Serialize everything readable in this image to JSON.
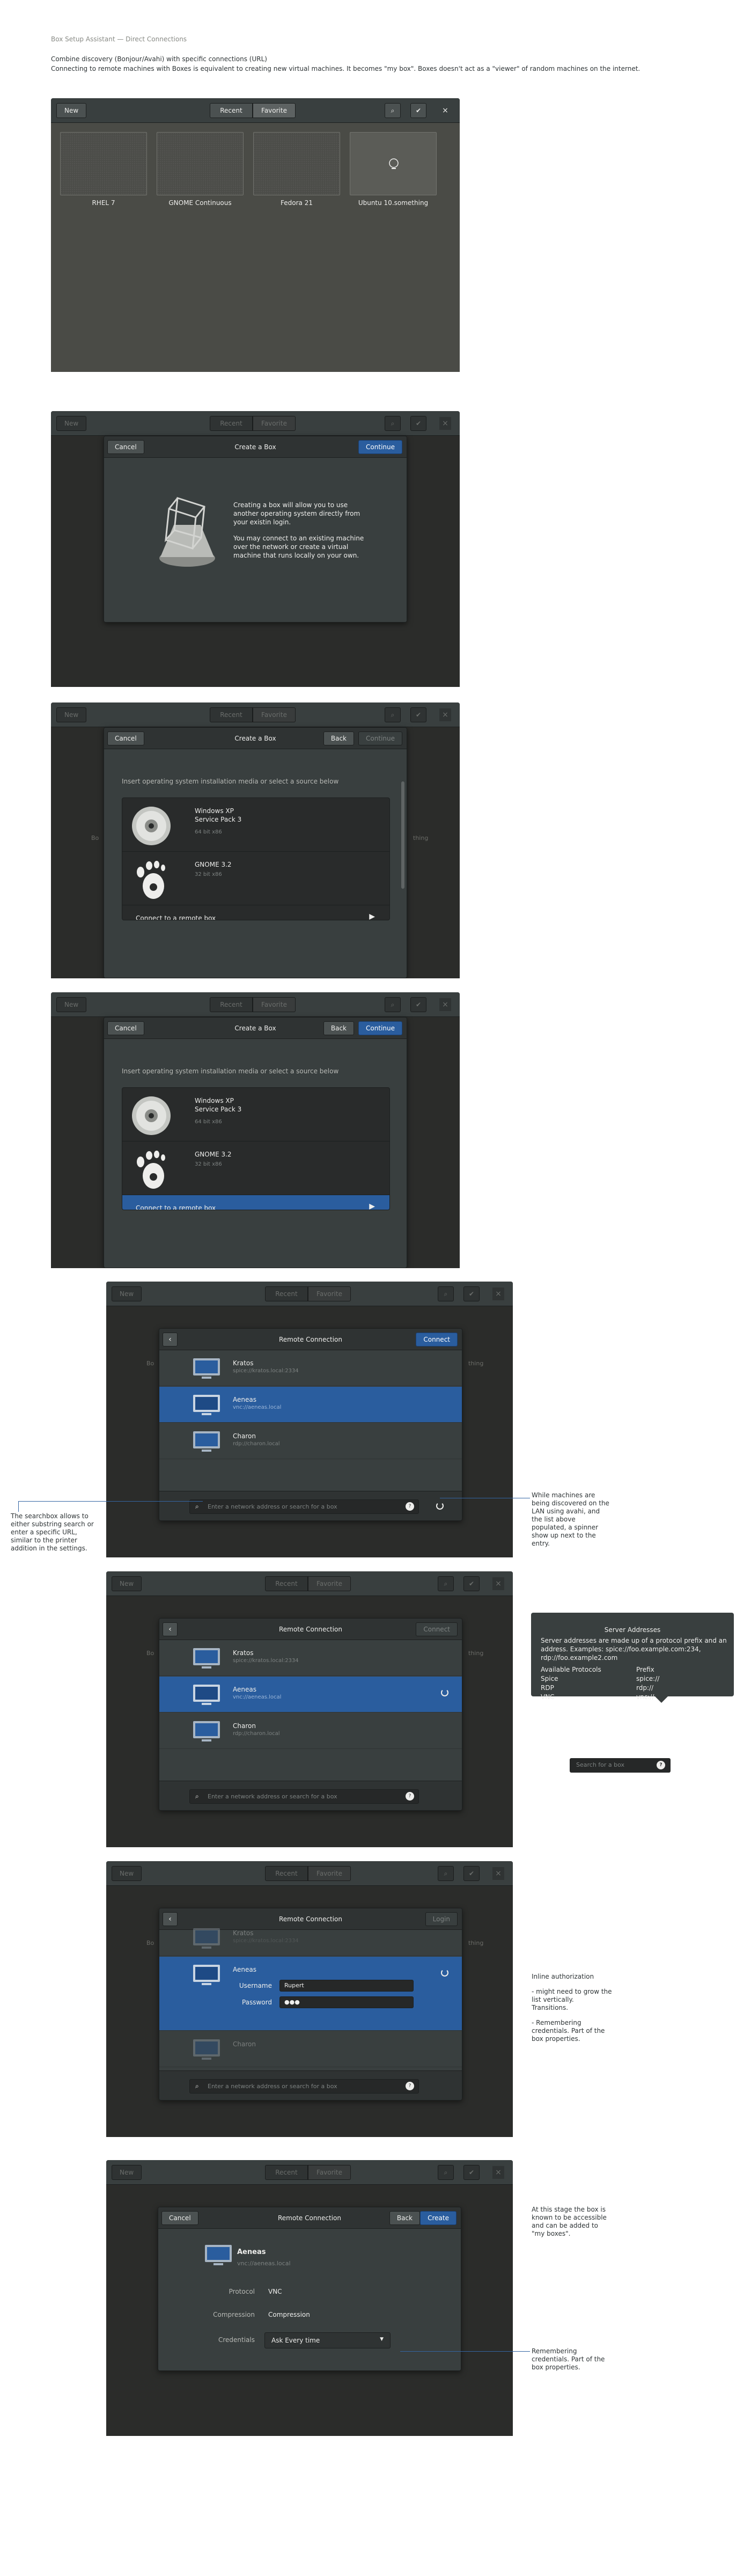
{
  "page": {
    "title": "Box Setup Assistant — Direct Connections",
    "desc1": "Combine discovery (Bonjour/Avahi) with specific connections (URL)",
    "desc2": "Connecting to remote machines with Boxes is equivalent to creating new virtual machines. It becomes \"my box\". Boxes doesn't act as a \"viewer\" of random machines on the internet."
  },
  "header": {
    "new_label": "New",
    "recent_label": "Recent",
    "favorite_label": "Favorite",
    "close_glyph": "×",
    "search_glyph": "⌕",
    "check_glyph": "✔"
  },
  "boxes": [
    {
      "label": "RHEL 7"
    },
    {
      "label": "GNOME Continuous"
    },
    {
      "label": "Fedora 21"
    },
    {
      "label": "Ubuntu 10.something"
    }
  ],
  "peek": {
    "left": "Bo",
    "right": "thing"
  },
  "create": {
    "title": "Create a Box",
    "cancel_label": "Cancel",
    "continue_label": "Continue",
    "back_label": "Back",
    "intro_p1": "Creating a box will allow you to use another operating system directly from your existin login.",
    "intro_p2": "You may connect to an existing machine over the network or create a virtual machine that runs locally on your own.",
    "instructions": "Insert operating system installation media or select a source below",
    "sources": [
      {
        "name": "Windows XP",
        "subtitle": "Service Pack 3",
        "size": "64 bit x86"
      },
      {
        "name": "GNOME 3.2",
        "subtitle": "",
        "size": "32 bit x86"
      }
    ],
    "remote_label": "Connect to a remote box",
    "remote_arrow": "▶"
  },
  "remote": {
    "title": "Remote Connection",
    "connect_label": "Connect",
    "login_label": "Login",
    "back_glyph": "‹",
    "search_placeholder": "Enter a network address or search for a box",
    "machines": [
      {
        "name": "Kratos",
        "address": "spice://kratos.local:2334"
      },
      {
        "name": "Aeneas",
        "address": "vnc://aeneas.local"
      },
      {
        "name": "Charon",
        "address": "rdp://charon.local"
      }
    ],
    "username_label": "Username",
    "username_value": "Rupert",
    "password_label": "Password",
    "password_value": "●●●"
  },
  "summary": {
    "cancel_label": "Cancel",
    "back_label": "Back",
    "create_label": "Create",
    "name": "Aeneas",
    "address": "vnc://aeneas.local",
    "protocol_label": "Protocol",
    "protocol_value": "VNC",
    "compression_label": "Compression",
    "compression_value": "Compression",
    "credentials_label": "Credentials",
    "credentials_value": "Ask Every time"
  },
  "popover": {
    "title": "Server Addresses",
    "desc": "Server addresses are made up  of a protocol prefix and an address. Examples: spice://foo.example.com:234, rdp://foo.example2.com",
    "col1_header": "Available Protocols",
    "col2_header": "Prefix",
    "rows": [
      {
        "proto": "Spice",
        "prefix": "spice://"
      },
      {
        "proto": "RDP",
        "prefix": "rdp://"
      },
      {
        "proto": "VNC",
        "prefix": "vnc://"
      }
    ],
    "mini_search": "Search for a box"
  },
  "annotations": {
    "searchbox": "The searchbox allows to either substring search or enter a specific URL, similar to the printer addition in the settings.",
    "discovery": "While machines are being discovered on the LAN using avahi, and the list above populated, a spinner show up next to the entry.",
    "inline_title": "Inline authorization",
    "inline_1": "- might need to grow the list vertically. Transitions.",
    "inline_2": "- Remembering credentials. Part of the box properties.",
    "known": "At this stage the box is known to be accessible and can be added to \"my boxes\".",
    "credentials": "Remembering credentials. Part of the box properties."
  },
  "colors": {
    "accent": "#2a5d9e",
    "dark": "#393f3f",
    "line": "#3465a4"
  }
}
